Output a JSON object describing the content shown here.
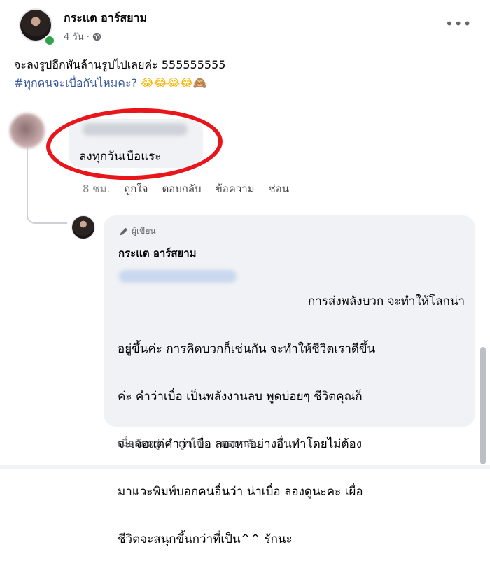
{
  "post": {
    "author": "กระแต อาร์สยาม",
    "time": "4 วัน ·",
    "more_label": "•••",
    "line1": "จะลงรูปอีกพันล้านรูปไปเลยค่ะ 555555555",
    "line2_text": "#ทุกคนจะเบื่อกันไหมคะ?",
    "line2_emoji": "😂😂😂😂🙈"
  },
  "comment": {
    "text": "ลงทุกวันเบือแระ",
    "actions": {
      "time": "8 ชม.",
      "like": "ถูกใจ",
      "reply": "ตอบกลับ",
      "message": "ข้อความ",
      "hide": "ซ่อน"
    }
  },
  "reply": {
    "badge": "ผู้เขียน",
    "author": "กระแต อาร์สยาม",
    "lines": [
      "การส่งพลังบวก จะทำให้โลกน่า",
      "อยู่ขึ้นค่ะ การคิดบวกก็เช่นกัน จะทำให้ชีวิตเราดีขึ้น",
      "ค่ะ คำว่าเบื่อ เป็นพลังงานลบ พูดบ่อยๆ ชีวิตคุณก็",
      "จะเจอแต่คำว่าเบื่อ  ลองหาอย่างอื่นทำโดยไม่ต้อง",
      "มาแวะพิมพ์บอกคนอื่นว่า น่าเบื่อ ลองดูนะคะ เผื่อ",
      "ชีวิตจะสนุกขึ้นกว่าที่เป็น^^ รักนะ"
    ],
    "actions": {
      "time": "เมื่อสักครู่",
      "like": "ถูกใจ",
      "reply": "ตอบกลับ"
    }
  },
  "colors": {
    "annotation_red": "#e8151b",
    "hashtag_blue": "#385898",
    "bubble_gray": "#f0f2f5"
  }
}
